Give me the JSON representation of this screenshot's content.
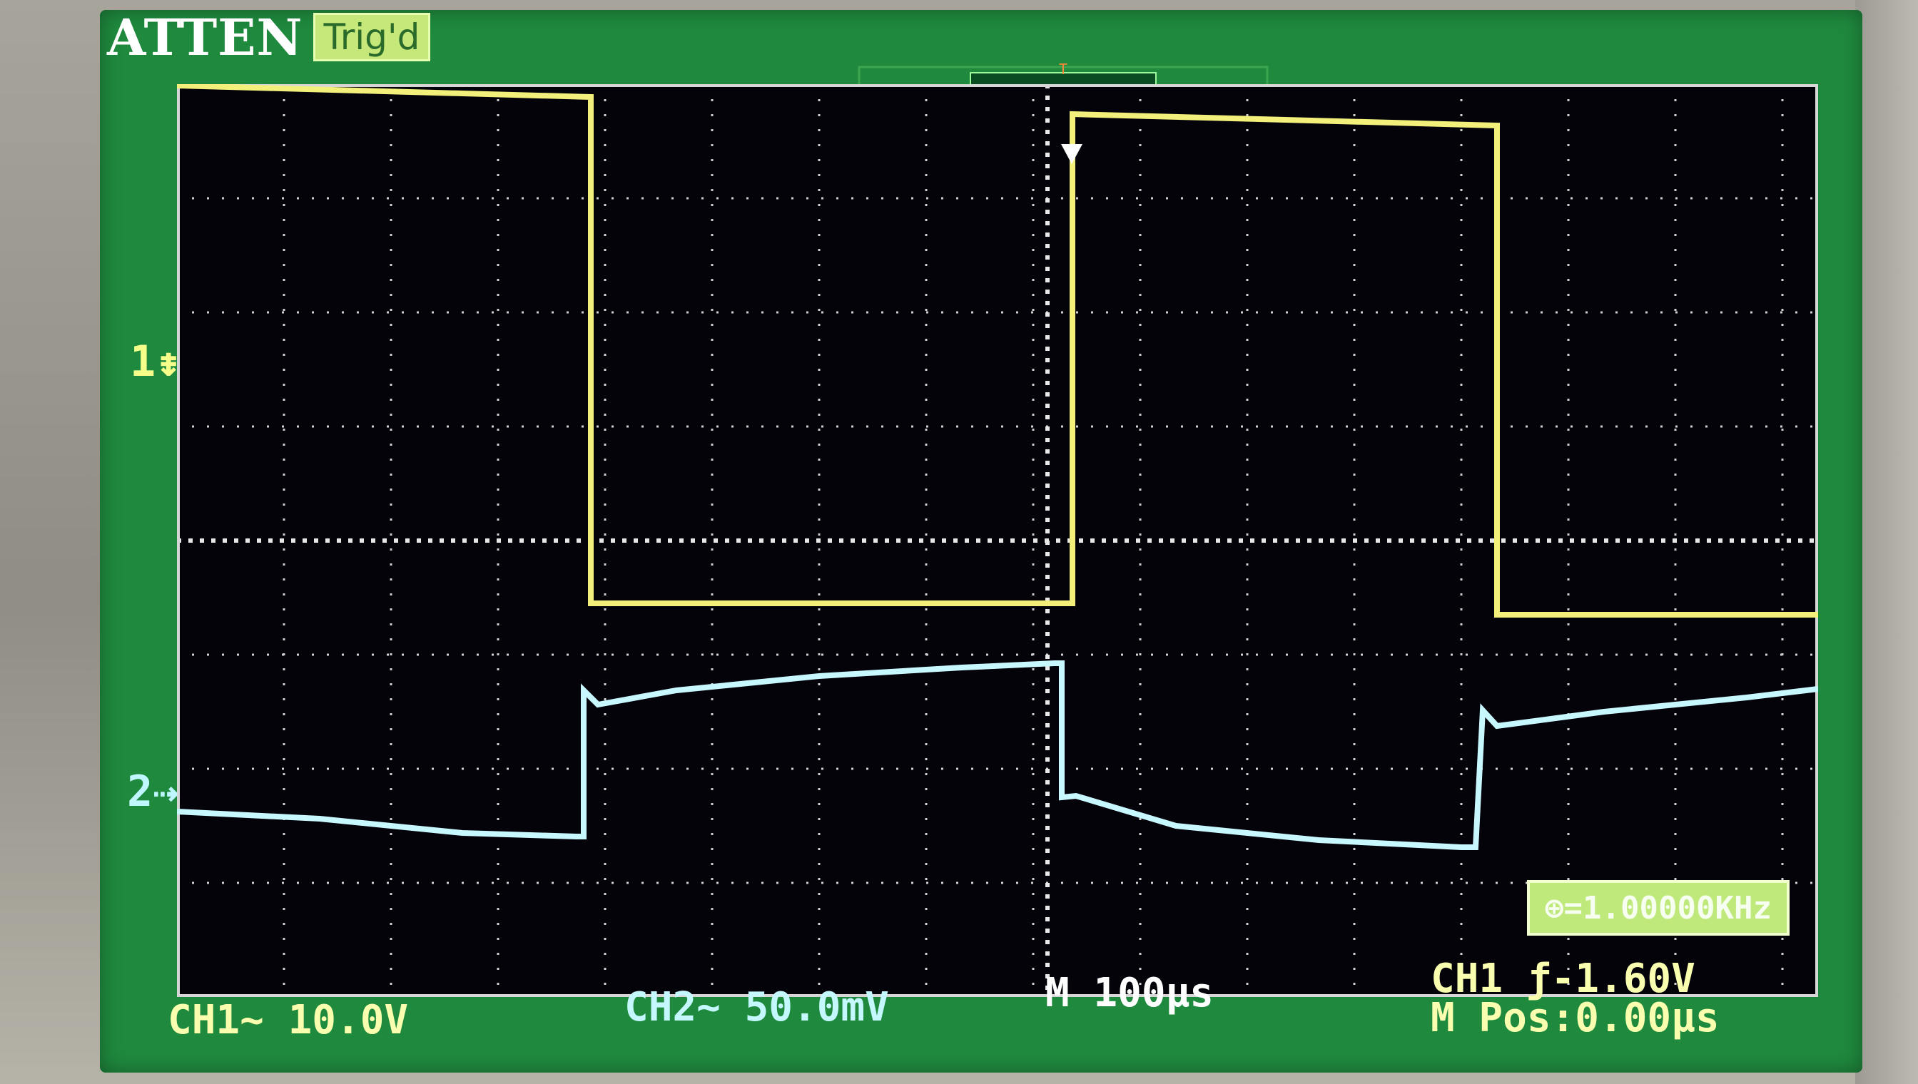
{
  "header": {
    "brand": "ATTEN",
    "trigger_status": "Trig'd"
  },
  "markers": {
    "ch1": "1⇟",
    "ch2": "2⇢"
  },
  "status_bar": {
    "ch1_scale": "CH1~ 10.0V",
    "ch2_scale": "CH2~ 50.0mV",
    "timebase": "M 100μs",
    "trigger_level": "CH1 ƒ-1.60V",
    "position": "M Pos:0.00μs",
    "frequency": "⊕=1.00000KHz"
  },
  "colors": {
    "ch1": "#f2f07a",
    "ch2": "#c8f8ff",
    "screen_bg": "#1f8a3e",
    "plot_bg": "#05030a",
    "grid": "#d8d8d8"
  },
  "icons": [
    "waveform-window-icon",
    "trigger-source-icon",
    "usb-drive-icon",
    "trigger-position-icon"
  ]
}
